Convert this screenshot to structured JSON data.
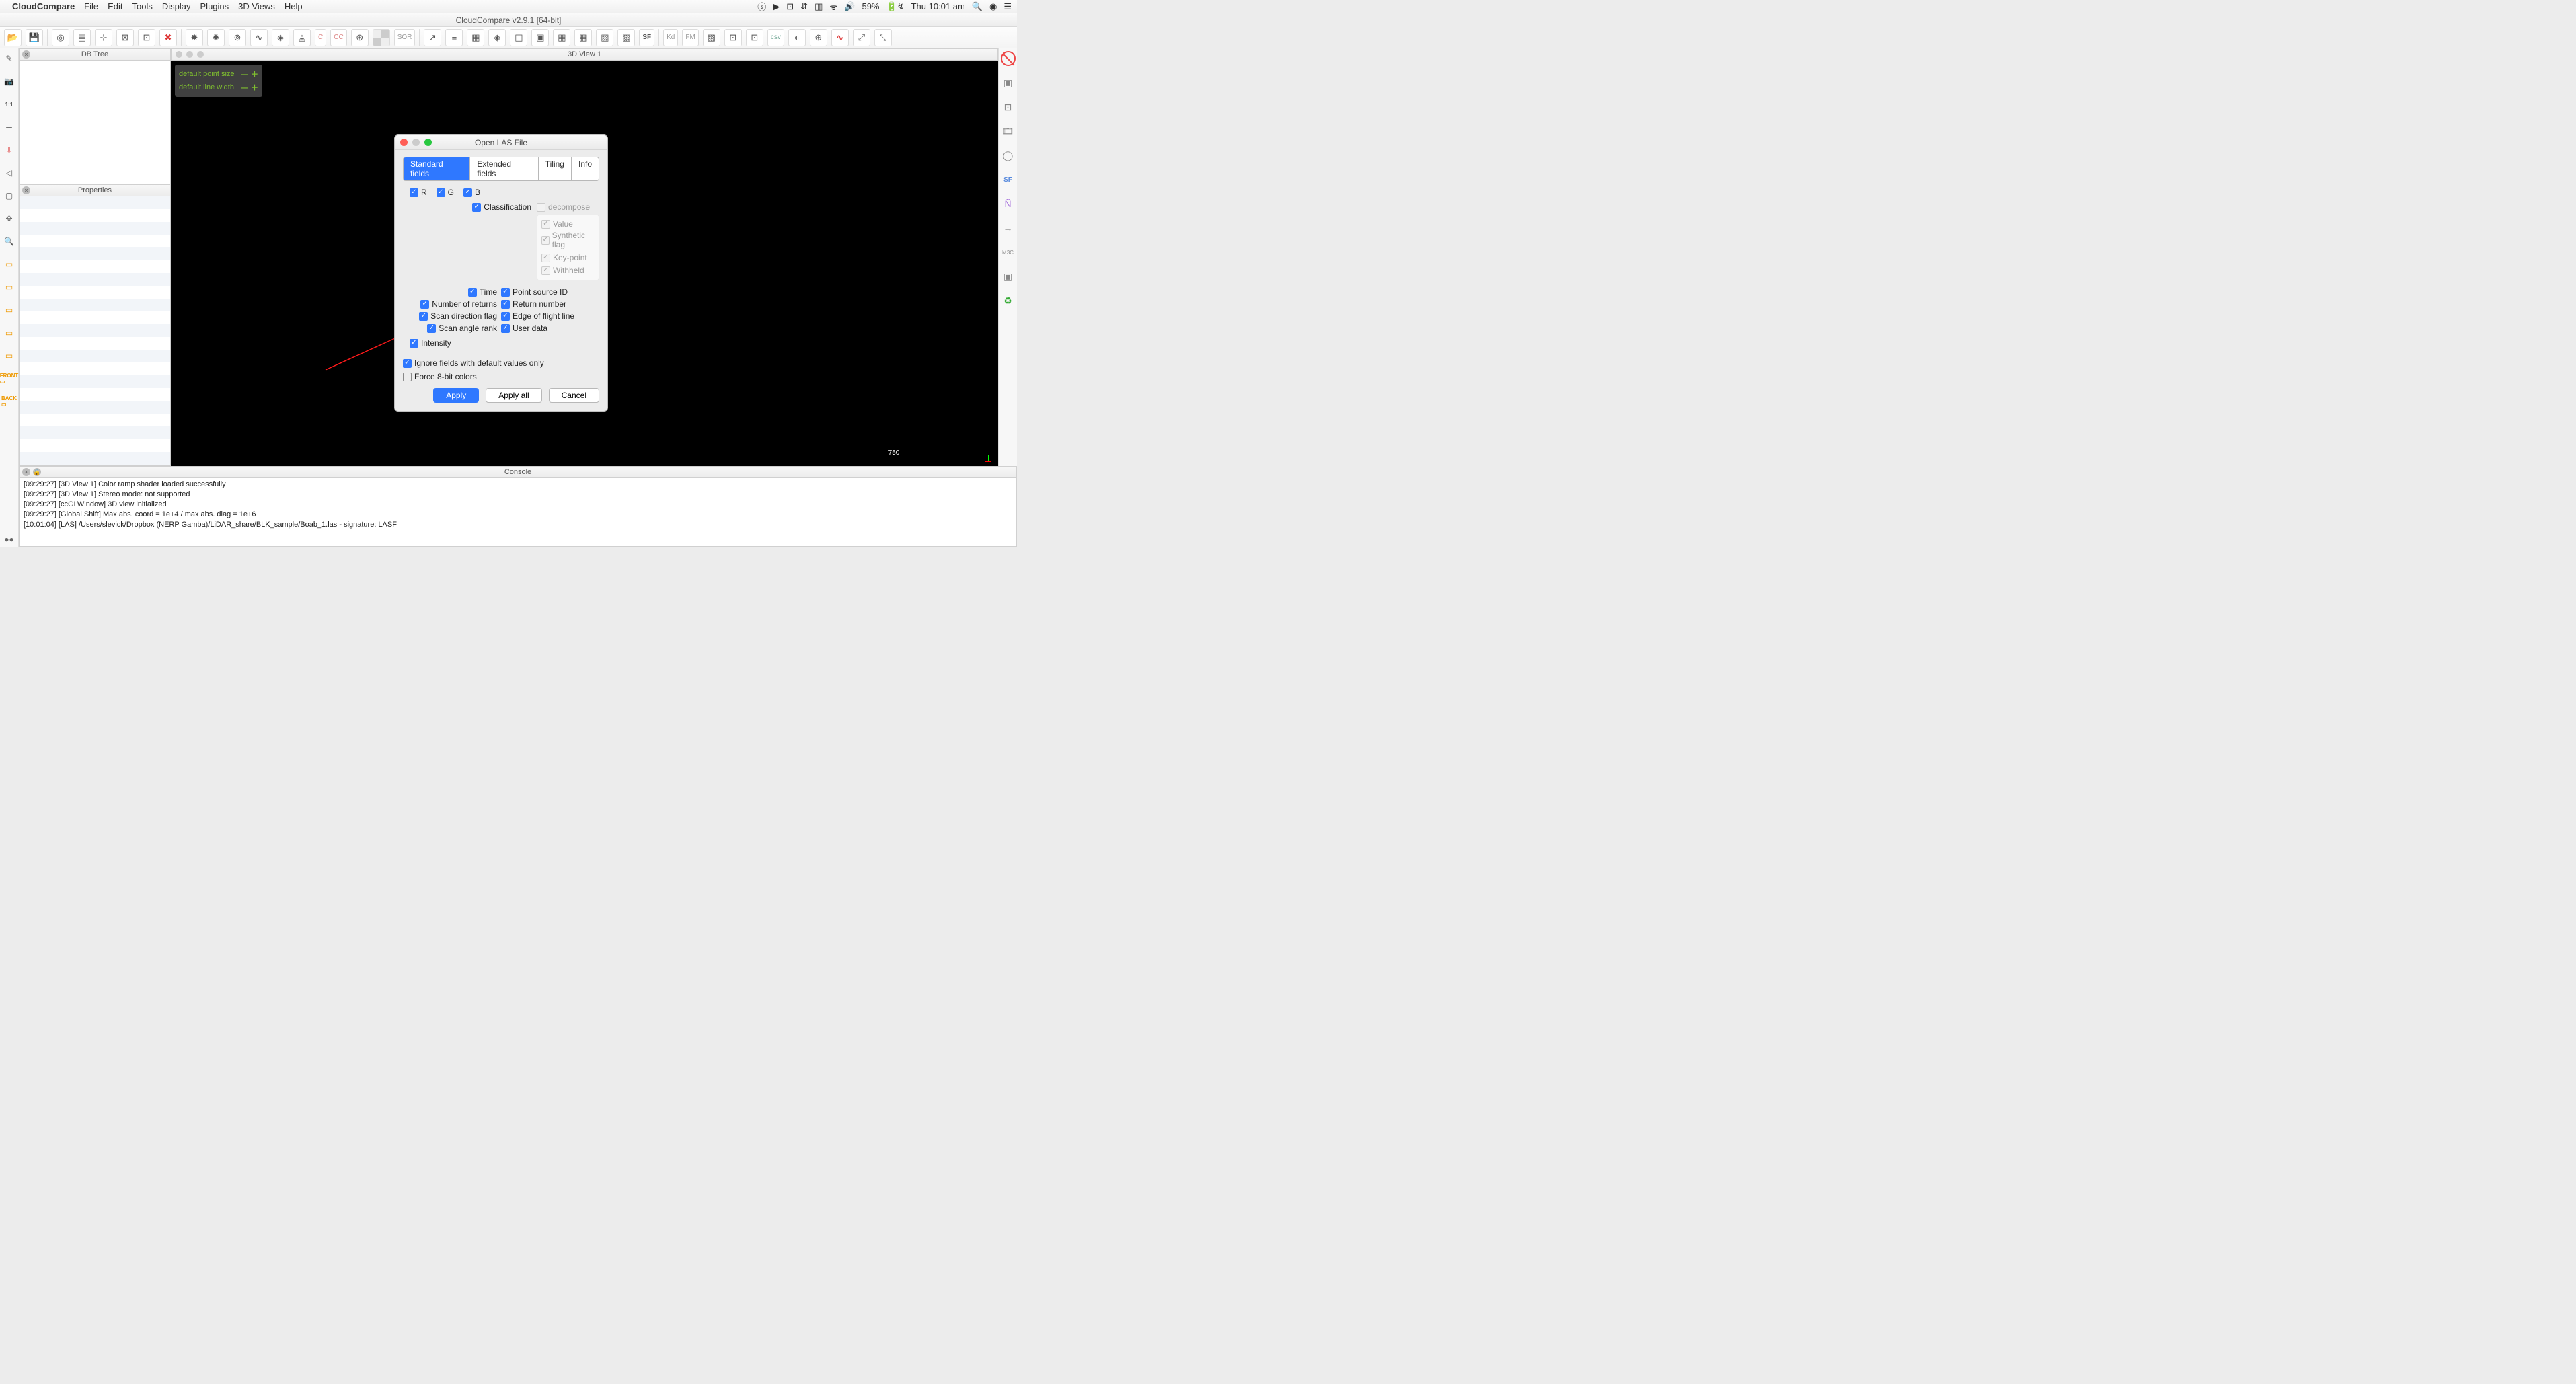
{
  "menubar": {
    "app": "CloudCompare",
    "items": [
      "File",
      "Edit",
      "Tools",
      "Display",
      "Plugins",
      "3D Views",
      "Help"
    ],
    "status": {
      "battery": "59%",
      "clock": "Thu 10:01 am"
    }
  },
  "window": {
    "title": "CloudCompare v2.9.1 [64-bit]"
  },
  "toolbar": {
    "icons": [
      "📂",
      "💾",
      "🔍",
      "📋",
      "⊞",
      "⊡",
      "⊟",
      "✖",
      "·",
      "·",
      "⊞",
      "⤴",
      "⊚",
      "∿",
      "SOR",
      "C",
      "CC",
      "⊞",
      "▦",
      "SOR",
      "↗",
      "≡",
      "⊞",
      "◈",
      "⊡",
      "⊞",
      "⊞",
      "⊞",
      "⊞",
      "SF",
      "Kd",
      "FM",
      "⊞",
      "⊡",
      "⊡",
      "csv",
      "◐",
      "⊕",
      "∿",
      "⤢",
      "⤢"
    ]
  },
  "panels": {
    "dbtree": "DB Tree",
    "properties": "Properties",
    "console": "Console",
    "view3d": "3D View 1"
  },
  "viewport": {
    "point_size_label": "default point size",
    "line_width_label": "default line width",
    "scale": "750"
  },
  "dialog": {
    "title": "Open LAS File",
    "tabs": [
      "Standard fields",
      "Extended fields",
      "Tiling",
      "Info"
    ],
    "rgb": [
      "R",
      "G",
      "B"
    ],
    "classification": "Classification",
    "decompose": "decompose",
    "sub": [
      "Value",
      "Synthetic flag",
      "Key-point",
      "Withheld"
    ],
    "pairs": [
      [
        "Time",
        "Point source ID"
      ],
      [
        "Number of returns",
        "Return number"
      ],
      [
        "Scan direction flag",
        "Edge of flight line"
      ],
      [
        "Scan angle rank",
        "User data"
      ]
    ],
    "intensity": "Intensity",
    "ignore": "Ignore fields with default values only",
    "force8": "Force 8-bit colors",
    "btn_apply": "Apply",
    "btn_applyall": "Apply all",
    "btn_cancel": "Cancel"
  },
  "console_lines": [
    "[09:29:27] [3D View 1] Color ramp shader loaded successfully",
    "[09:29:27] [3D View 1] Stereo mode: not supported",
    "[09:29:27] [ccGLWindow] 3D view initialized",
    "[09:29:27] [Global Shift] Max abs. coord = 1e+4 / max abs. diag = 1e+6",
    "[10:01:04] [LAS] /Users/slevick/Dropbox (NERP Gamba)/LiDAR_share/BLK_sample/Boab_1.las - signature: LASF"
  ],
  "left_icons": [
    "✎",
    "📷",
    "1:1",
    "＋",
    "⇩",
    "◁",
    "▢",
    "＋",
    "🔍",
    "▭",
    "▭",
    "▭",
    "▭",
    "▭",
    "FRONT",
    "BACK",
    "🎞"
  ],
  "right_icons": [
    "⦸",
    "▣",
    "⊡",
    "🎞",
    "◯",
    "SF",
    "N",
    "→",
    "M3C",
    "▣",
    "♻"
  ]
}
